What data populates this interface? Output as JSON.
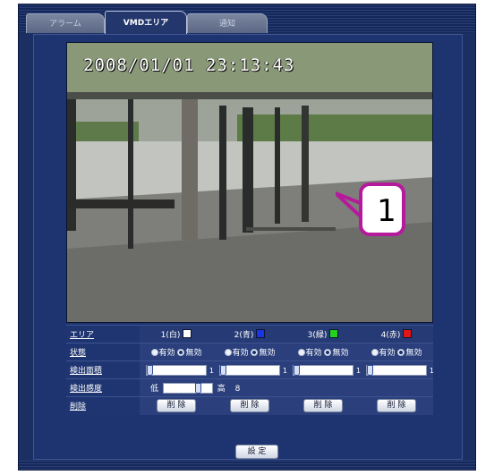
{
  "tabs": [
    {
      "label": "アラーム",
      "active": false
    },
    {
      "label": "VMDエリア",
      "active": true
    },
    {
      "label": "通知",
      "active": false
    }
  ],
  "camera": {
    "timestamp": "2008/01/01  23:13:43",
    "callout_number": "1"
  },
  "settings": {
    "area_label": "エリア",
    "areas": [
      {
        "label": "1(白)",
        "color": "#ffffff"
      },
      {
        "label": "2(青)",
        "color": "#1a35e6"
      },
      {
        "label": "3(緑)",
        "color": "#22d21b"
      },
      {
        "label": "4(赤)",
        "color": "#e61414"
      }
    ],
    "status_label": "状態",
    "enabled_label": "有効",
    "disabled_label": "無効",
    "status_values": [
      "無効",
      "無効",
      "無効",
      "無効"
    ],
    "detection_area_label": "検出面積",
    "detection_area_values": [
      "1",
      "1",
      "1",
      "1"
    ],
    "sensitivity_label": "検出感度",
    "sensitivity_low": "低",
    "sensitivity_high": "高",
    "sensitivity_value": "8",
    "delete_label": "削除",
    "delete_button": "削 除"
  },
  "set_button": "設 定"
}
